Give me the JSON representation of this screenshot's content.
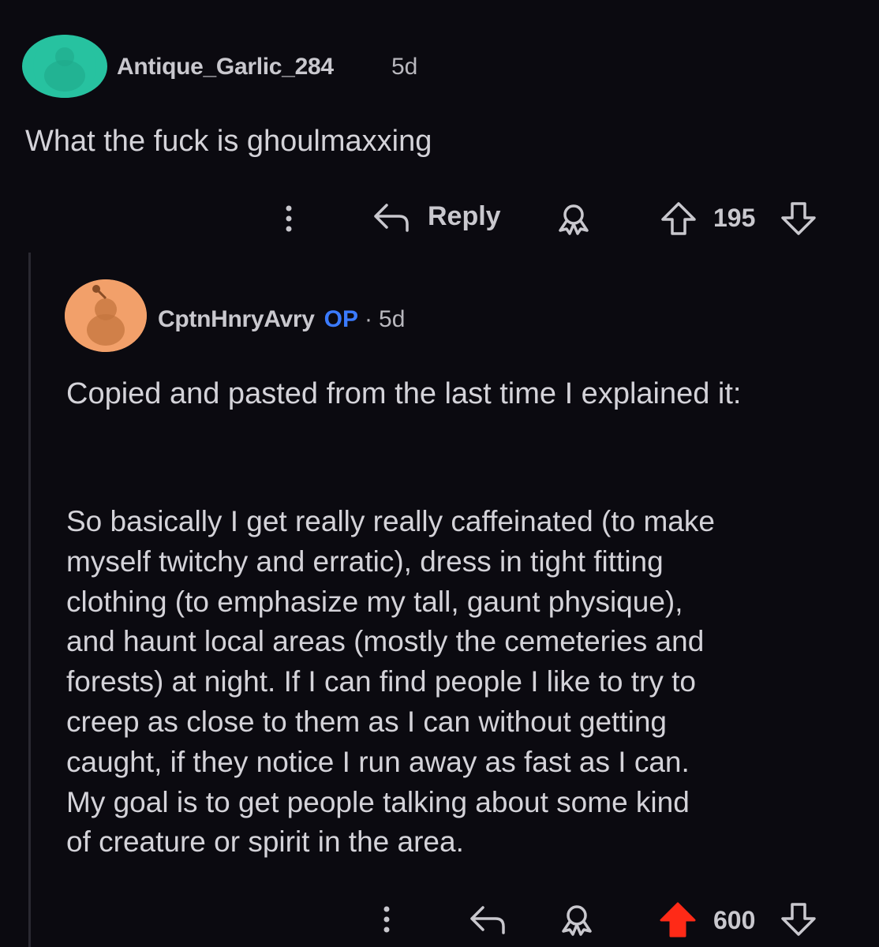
{
  "comments": [
    {
      "username": "Antique_Garlic_284",
      "age": "5d",
      "text": "What the fuck is ghoulmaxxing",
      "reply_label": "Reply",
      "votes": "195",
      "avatar_color": "#27c2a0"
    },
    {
      "username": "CptnHnryAvry",
      "op_badge": "OP",
      "separator": "·",
      "age": "5d",
      "paragraph1": "Copied and pasted from the last time I explained it:",
      "paragraph2_lines": [
        "So basically I get really really caffeinated (to make",
        "myself twitchy and erratic), dress in tight fitting",
        "clothing (to emphasize my tall, gaunt physique),",
        "and haunt local areas (mostly the cemeteries and",
        "forests) at night. If I can find people I like to try to",
        "creep as close to them as I can without getting",
        "caught, if they notice I run away as fast as I can.",
        "My goal is to get people talking about some kind",
        "of creature or spirit in the area."
      ],
      "votes": "600",
      "upvoted": true,
      "upvote_color": "#ff2a17",
      "avatar_color": "#f2a06a"
    }
  ],
  "colors": {
    "background": "#0b0a10",
    "op_badge": "#3b7bff"
  }
}
